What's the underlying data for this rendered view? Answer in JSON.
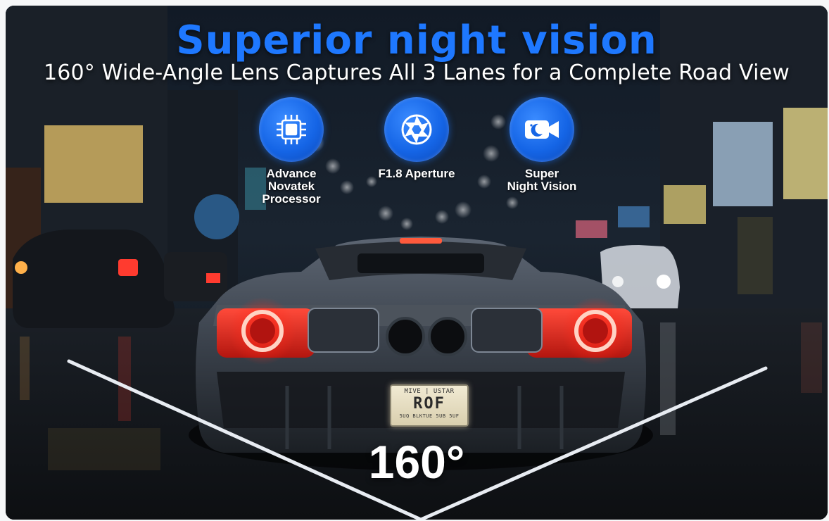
{
  "headline": "Superior night vision",
  "subheadline": "160° Wide-Angle Lens Captures All 3 Lanes for a Complete Road View",
  "features": [
    {
      "icon": "processor-chip-icon",
      "label": "Advance\nNovatek\nProcessor"
    },
    {
      "icon": "aperture-icon",
      "label": "F1.8 Aperture"
    },
    {
      "icon": "night-camera-icon",
      "label": "Super\nNight Vision"
    }
  ],
  "angle_label": "160°",
  "license_plate": {
    "top": "MIVE | USTAR",
    "main": "ROF",
    "bottom": "5UQ BLKTUE 5UB 5UF"
  },
  "colors": {
    "headline": "#1e78ff",
    "icon_disc": "#1565e6",
    "tail_light": "#ff3b2f"
  }
}
